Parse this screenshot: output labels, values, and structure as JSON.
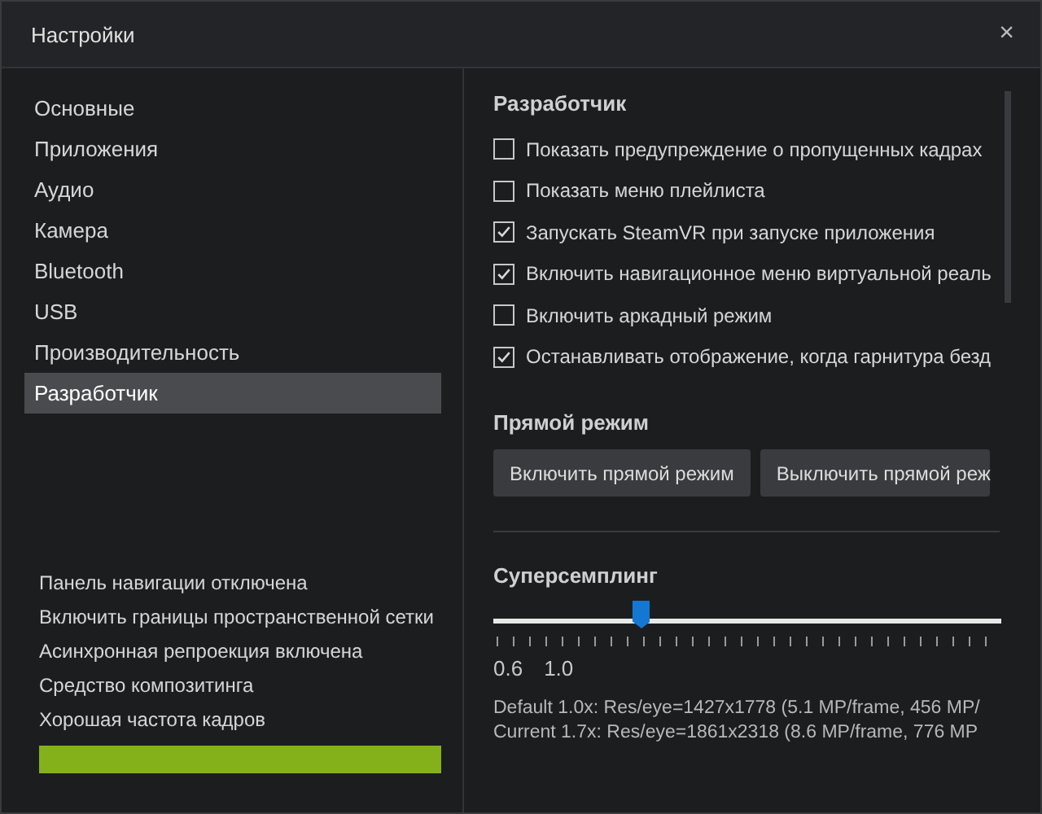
{
  "window": {
    "title": "Настройки",
    "close": "×"
  },
  "sidebar": {
    "items": [
      {
        "label": "Основные",
        "selected": false
      },
      {
        "label": "Приложения",
        "selected": false
      },
      {
        "label": "Аудио",
        "selected": false
      },
      {
        "label": "Камера",
        "selected": false
      },
      {
        "label": "Bluetooth",
        "selected": false
      },
      {
        "label": "USB",
        "selected": false
      },
      {
        "label": "Производительность",
        "selected": false
      },
      {
        "label": "Разработчик",
        "selected": true
      }
    ],
    "status": [
      "Панель навигации отключена",
      "Включить границы пространственной сетки",
      "Асинхронная репроекция включена",
      "Средство композитинга",
      "Хорошая частота кадров"
    ]
  },
  "developer": {
    "title": "Разработчик",
    "options": [
      {
        "label": "Показать предупреждение о пропущенных кадрах",
        "checked": false
      },
      {
        "label": "Показать меню плейлиста",
        "checked": false
      },
      {
        "label": "Запускать SteamVR при запуске приложения",
        "checked": true
      },
      {
        "label": "Включить навигационное меню виртуальной реаль",
        "checked": true
      },
      {
        "label": "Включить аркадный режим",
        "checked": false
      },
      {
        "label": "Останавливать отображение, когда гарнитура безд",
        "checked": true
      }
    ]
  },
  "direct_mode": {
    "title": "Прямой режим",
    "buttons": [
      "Включить прямой режим",
      "Выключить прямой реж"
    ]
  },
  "supersampling": {
    "title": "Суперсемплинг",
    "level": 0.29,
    "tick_labels": [
      "0.6",
      "1.0"
    ],
    "info": [
      "Default 1.0x: Res/eye=1427x1778 (5.1 MP/frame, 456 MP/",
      "Current 1.7x: Res/eye=1861x2318 (8.6 MP/frame, 776 MP"
    ]
  }
}
